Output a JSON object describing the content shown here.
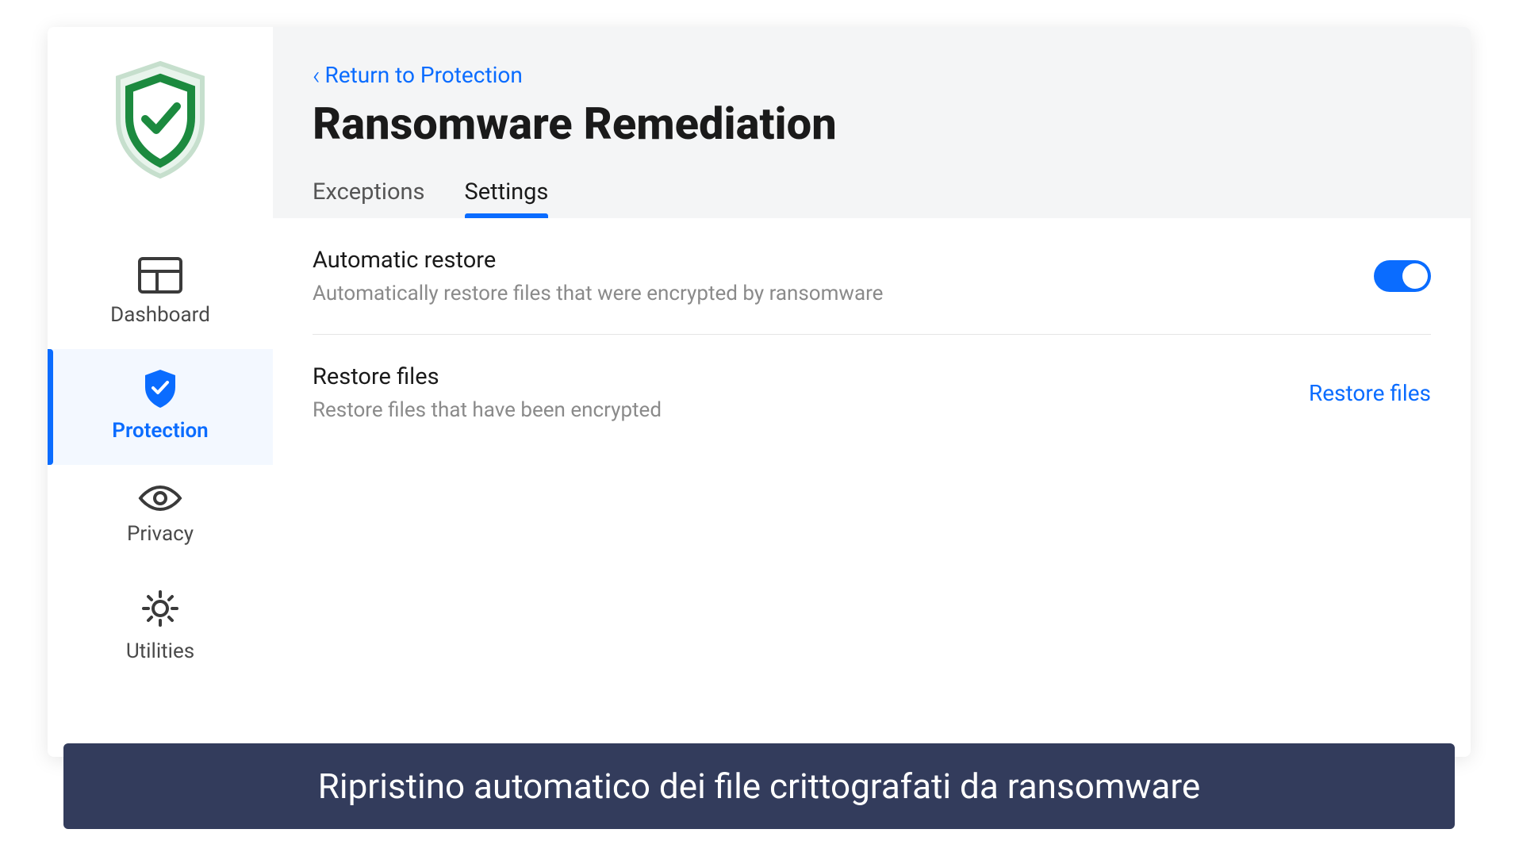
{
  "sidebar": {
    "items": [
      {
        "label": "Dashboard"
      },
      {
        "label": "Protection"
      },
      {
        "label": "Privacy"
      },
      {
        "label": "Utilities"
      }
    ]
  },
  "header": {
    "back_label": "Return to Protection",
    "title": "Ransomware Remediation"
  },
  "tabs": [
    {
      "label": "Exceptions"
    },
    {
      "label": "Settings"
    }
  ],
  "settings": {
    "auto_restore": {
      "title": "Automatic restore",
      "desc": "Automatically restore files that were encrypted by ransomware",
      "enabled": true
    },
    "restore_files": {
      "title": "Restore files",
      "desc": "Restore files that have been encrypted",
      "action_label": "Restore files"
    }
  },
  "caption": "Ripristino automatico dei file crittografati da ransomware",
  "colors": {
    "accent": "#0a6cff",
    "caption_bg": "#333c5c"
  }
}
